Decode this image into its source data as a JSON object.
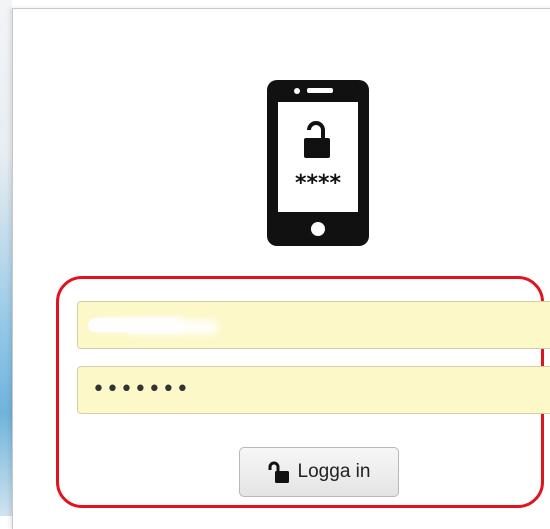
{
  "icons": {
    "phone": "phone-lock-icon",
    "button": "unlock-icon"
  },
  "phone": {
    "pin_mask": "****"
  },
  "form": {
    "username_value": "",
    "password_value": "•••••••",
    "login_label": "Logga in"
  },
  "colors": {
    "field_background": "#fcf8c8",
    "annotation_outline": "#e0141e"
  }
}
